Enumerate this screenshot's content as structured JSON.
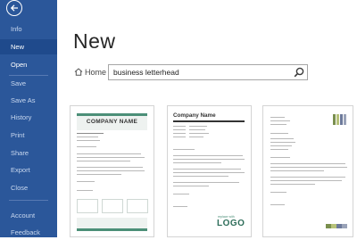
{
  "backstage": {
    "back_button": "back-arrow-icon",
    "items": [
      {
        "label": "Info"
      },
      {
        "label": "New"
      },
      {
        "label": "Open"
      },
      {
        "label": "Save"
      },
      {
        "label": "Save As"
      },
      {
        "label": "History"
      },
      {
        "label": "Print"
      },
      {
        "label": "Share"
      },
      {
        "label": "Export"
      },
      {
        "label": "Close"
      },
      {
        "label": "Account"
      },
      {
        "label": "Feedback"
      }
    ],
    "active_item": "New"
  },
  "main": {
    "title": "New",
    "home_label": "Home",
    "search": {
      "value": "business letterhead",
      "icon": "search-icon"
    }
  },
  "templates": [
    {
      "company_name": "COMPANY NAME",
      "accent_color": "#4c8f78"
    },
    {
      "company_name": "Company Name",
      "logo_caption": "replace with",
      "logo_text": "LOGO",
      "accent_color": "#2e6e5a"
    },
    {
      "accent_color": "#8a9a5b"
    }
  ],
  "colors": {
    "sidebar": "#2b579a",
    "sidebar_active": "#1f4a8c",
    "accent_green": "#4c8f78"
  }
}
